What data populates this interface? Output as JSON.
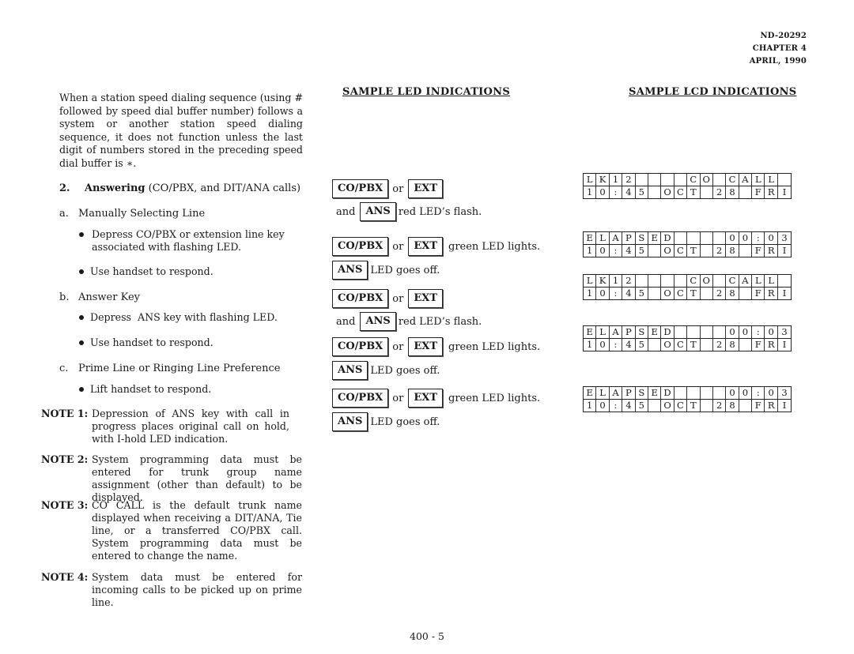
{
  "header": {
    "doc_number": "ND-20292",
    "chapter": "CHAPTER 4",
    "date": "APRIL, 1990"
  },
  "intro_paragraph": "When a station speed dialing sequence (using # followed by speed dial buffer number) follows a system or another station speed dialing sequence, it does not function unless the last digit of numbers stored in the preceding speed dial buffer is ∗.",
  "section": {
    "number": "2.",
    "title_bold": "Answering",
    "title_rest": " (CO/PBX, and DIT/ANA calls)"
  },
  "subsections": [
    {
      "letter": "a.",
      "title": "Manually Selecting Line",
      "bullets": [
        "Depress CO/PBX or extension line key associated with flashing LED.",
        "Use handset to respond."
      ]
    },
    {
      "letter": "b.",
      "title": "Answer Key",
      "bullets": [
        "Depress  ANS key with flashing LED.",
        "Use handset to respond."
      ]
    },
    {
      "letter": "c.",
      "title": "Prime Line or Ringing Line Preference",
      "bullets": [
        "Lift handset to respond."
      ]
    }
  ],
  "notes": [
    {
      "label": "NOTE 1:",
      "text": "Depression of ANS key with call in progress places original call on hold, with I-hold LED indication."
    },
    {
      "label": "NOTE 2:",
      "text": "System programming data must be entered for trunk group name assignment (other than default) to be displayed."
    },
    {
      "label": "NOTE 3:",
      "text": "CO CALL is the default trunk name displayed when receiving a DIT/ANA, Tie line, or a transferred CO/PBX call. System programming data must be entered to change the name."
    },
    {
      "label": "NOTE 4:",
      "text": "System data must be entered for incoming calls to be picked up on prime line."
    }
  ],
  "led_section": {
    "title": "SAMPLE LED INDICATIONS",
    "keys": {
      "copbx": "CO/PBX",
      "ext": "EXT",
      "ans": "ANS"
    },
    "words": {
      "or": "or",
      "and": "and"
    },
    "phrases": {
      "red_flash": "red LED’s flash.",
      "green_lights": "green LED lights.",
      "goes_off": "LED goes off."
    }
  },
  "lcd_section": {
    "title": "SAMPLE LCD INDICATIONS",
    "displays": [
      {
        "line1": "LK12    CO CALL ",
        "line2": "10:45 OCT 28 FRI"
      },
      {
        "line1": "ELAPSED    00:03",
        "line2": "10:45 OCT 28 FRI"
      },
      {
        "line1": "LK12    CO CALL ",
        "line2": "10:45 OCT 28 FRI"
      },
      {
        "line1": "ELAPSED    00:03",
        "line2": "10:45 OCT 28 FRI"
      },
      {
        "line1": "ELAPSED    00:03",
        "line2": "10:45 OCT 28 FRI"
      }
    ]
  },
  "page_number": "400 - 5"
}
